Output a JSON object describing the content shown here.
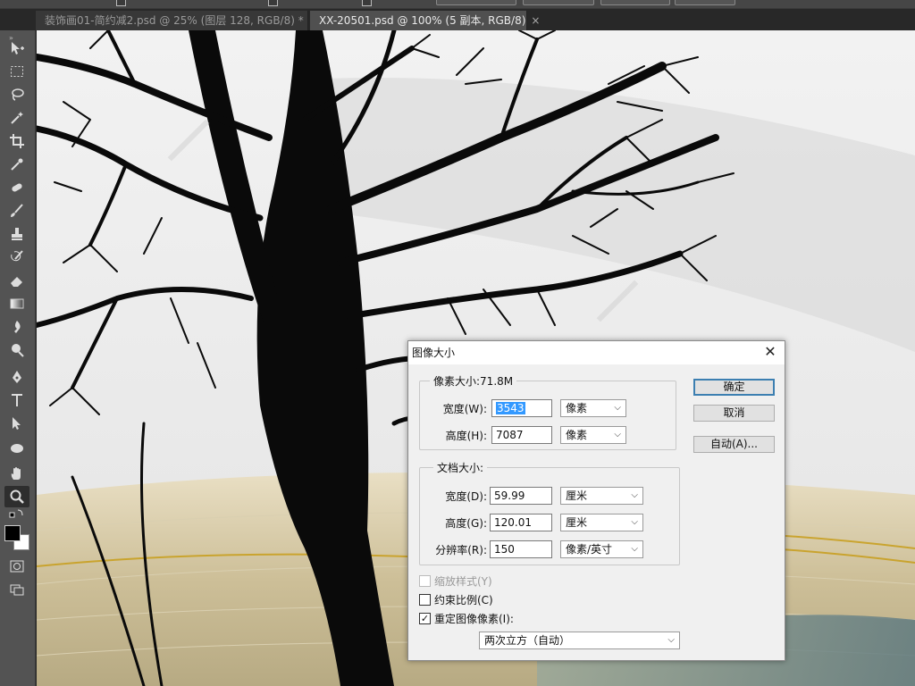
{
  "tabs": [
    {
      "label": "装饰画01-简约减2.psd @ 25% (图层 128, RGB/8) *",
      "close": "×"
    },
    {
      "label": "XX-20501.psd @ 100% (5 副本, RGB/8)",
      "close": "×"
    }
  ],
  "toolbar": {
    "collapse": "»"
  },
  "dialog": {
    "title": "图像大小",
    "close": "✕",
    "pixel_dimensions": {
      "legend": "像素大小:71.8M",
      "width_label": "宽度(W):",
      "width_value": "3543",
      "width_unit": "像素",
      "height_label": "高度(H):",
      "height_value": "7087",
      "height_unit": "像素"
    },
    "document_size": {
      "legend": "文档大小:",
      "width_label": "宽度(D):",
      "width_value": "59.99",
      "width_unit": "厘米",
      "height_label": "高度(G):",
      "height_value": "120.01",
      "height_unit": "厘米",
      "resolution_label": "分辨率(R):",
      "resolution_value": "150",
      "resolution_unit": "像素/英寸"
    },
    "buttons": {
      "ok": "确定",
      "cancel": "取消",
      "auto": "自动(A)..."
    },
    "checkboxes": {
      "scale_styles": "缩放样式(Y)",
      "constrain": "约束比例(C)",
      "resample": "重定图像像素(I):"
    },
    "resample_method": "两次立方（自动）",
    "chevron": "⌵",
    "check": "✓"
  }
}
